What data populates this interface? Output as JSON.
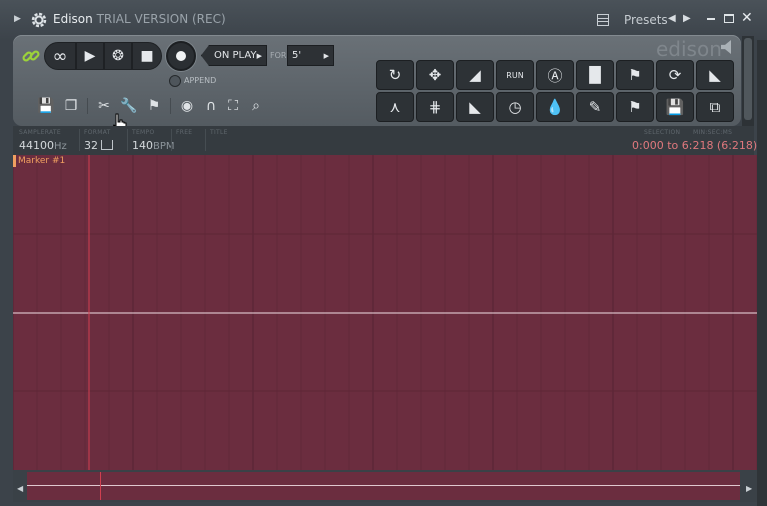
{
  "titlebar": {
    "app": "Edison",
    "subtitle": "TRIAL VERSION (REC)",
    "presets_label": "Presets",
    "prev_glyph": "◀",
    "next_glyph": "▶",
    "close_glyph": "✕"
  },
  "transport": {
    "loop_glyph": "∞",
    "play_glyph": "▶",
    "scrub_glyph": "❂",
    "stop_glyph": "■",
    "record_mode": "ON PLAY",
    "for_label": "FOR",
    "for_value": "5'",
    "append_label": "APPEND"
  },
  "branding": {
    "logo": "edison"
  },
  "tools": [
    {
      "name": "reverse-icon",
      "glyph": "↻"
    },
    {
      "name": "normalize-icon",
      "glyph": "✥"
    },
    {
      "name": "fade-in-icon",
      "glyph": "◢"
    },
    {
      "name": "run-icon",
      "glyph": "RUN"
    },
    {
      "name": "eq-icon",
      "glyph": "Ⓐ"
    },
    {
      "name": "spectrum-icon",
      "glyph": "▐▌"
    },
    {
      "name": "add-marker-icon",
      "glyph": "⚑"
    },
    {
      "name": "loop-tool-icon",
      "glyph": "⟳"
    },
    {
      "name": "select-tool-icon",
      "glyph": "◣"
    },
    {
      "name": "split-icon",
      "glyph": "⋏"
    },
    {
      "name": "noise-icon",
      "glyph": "⋕"
    },
    {
      "name": "fade-out-icon",
      "glyph": "◣"
    },
    {
      "name": "time-stretch-icon",
      "glyph": "◷"
    },
    {
      "name": "blur-icon",
      "glyph": "💧"
    },
    {
      "name": "feather-icon",
      "glyph": "✎"
    },
    {
      "name": "marker-move-icon",
      "glyph": "⚑"
    },
    {
      "name": "save-sample-icon",
      "glyph": "💾"
    },
    {
      "name": "send-to-channel-icon",
      "glyph": "⧉"
    }
  ],
  "small_tools": {
    "save": "💾",
    "copy": "❐",
    "cut": "✂",
    "wrench": "🔧",
    "flag": "⚑",
    "eye": "◉",
    "magnet": "∩",
    "select": "⛶",
    "zoom": "⌕"
  },
  "info": {
    "samplerate_label": "SAMPLERATE",
    "samplerate_value": "44100",
    "samplerate_unit": "Hz",
    "format_label": "FORMAT",
    "format_value": "32",
    "tempo_label": "TEMPO",
    "tempo_value": "140",
    "tempo_unit": "BPM",
    "free_label": "FREE",
    "title_label": "TITLE",
    "selection_label": "SELECTION",
    "time_format_label": "MIN:SEC:MS",
    "selection_value": "0:000 to 6:218 (6:218)"
  },
  "waveform": {
    "marker_label": "Marker #1"
  },
  "colors": {
    "wave_bg": "#6b2d3f",
    "selection_text": "#e0787d",
    "marker": "#f0a060",
    "link_green": "#9cd33a"
  }
}
